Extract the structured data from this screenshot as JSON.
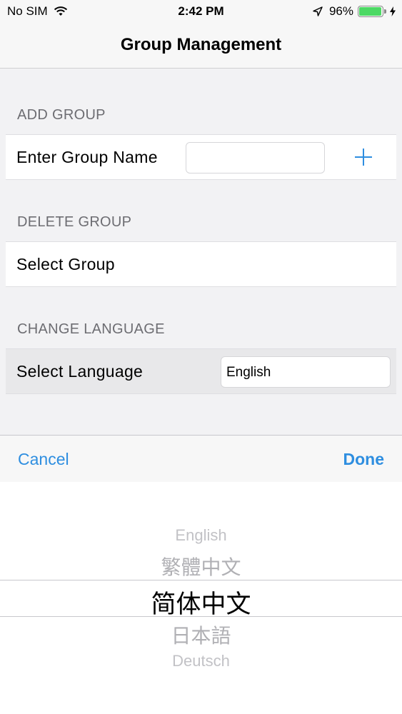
{
  "status_bar": {
    "carrier": "No SIM",
    "time": "2:42 PM",
    "battery": "96%",
    "battery_level": 0.96,
    "icons": [
      "wifi-icon",
      "location-arrow-icon",
      "battery-icon",
      "charging-bolt-icon"
    ]
  },
  "nav": {
    "title": "Group Management"
  },
  "add_group": {
    "header": "ADD GROUP",
    "label": "Enter Group Name",
    "input_value": "",
    "add_icon": "plus-icon"
  },
  "delete_group": {
    "header": "DELETE GROUP",
    "label": "Select Group"
  },
  "change_language": {
    "header": "CHANGE LANGUAGE",
    "label": "Select Language",
    "value": "English"
  },
  "toolbar": {
    "cancel": "Cancel",
    "done": "Done"
  },
  "picker": {
    "options": [
      "English",
      "繁體中文",
      "简体中文",
      "日本語",
      "Deutsch"
    ],
    "selected": "简体中文"
  },
  "colors": {
    "accent": "#2e8ee0",
    "battery": "#4cd964",
    "section_header": "#6d6d72",
    "background": "#f2f2f4"
  }
}
